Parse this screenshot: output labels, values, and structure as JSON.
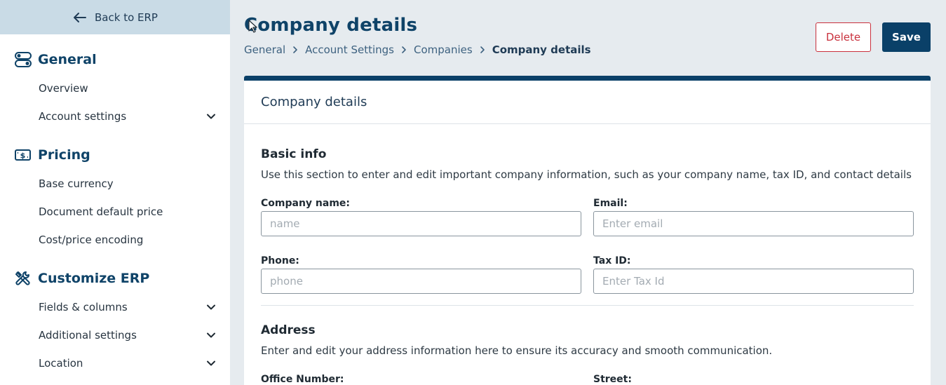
{
  "sidebar": {
    "back_label": "Back to ERP",
    "sections": [
      {
        "title": "General",
        "icon": "toggle-settings-icon",
        "items": [
          {
            "label": "Overview",
            "expandable": false
          },
          {
            "label": "Account settings",
            "expandable": true
          }
        ]
      },
      {
        "title": "Pricing",
        "icon": "currency-icon",
        "items": [
          {
            "label": "Base currency",
            "expandable": false
          },
          {
            "label": "Document default price",
            "expandable": false
          },
          {
            "label": "Cost/price encoding",
            "expandable": false
          }
        ]
      },
      {
        "title": "Customize ERP",
        "icon": "tools-icon",
        "items": [
          {
            "label": "Fields & columns",
            "expandable": true
          },
          {
            "label": "Additional settings",
            "expandable": true
          },
          {
            "label": "Location",
            "expandable": true
          }
        ]
      }
    ]
  },
  "header": {
    "title": "Company details",
    "breadcrumb": [
      "General",
      "Account Settings",
      "Companies",
      "Company details"
    ],
    "delete_label": "Delete",
    "save_label": "Save"
  },
  "card": {
    "title": "Company details",
    "basic": {
      "title": "Basic info",
      "description": "Use this section to enter and edit important company information, such as your company name, tax ID, and contact details",
      "company_name": {
        "label": "Company name:",
        "placeholder": "name",
        "value": ""
      },
      "email": {
        "label": "Email:",
        "placeholder": "Enter email",
        "value": ""
      },
      "phone": {
        "label": "Phone:",
        "placeholder": "phone",
        "value": ""
      },
      "tax_id": {
        "label": "Tax ID:",
        "placeholder": "Enter Tax Id",
        "value": ""
      }
    },
    "address": {
      "title": "Address",
      "description": "Enter and edit your address information here to ensure its accuracy and smooth communication.",
      "office_number": {
        "label": "Office Number:"
      },
      "street": {
        "label": "Street:"
      }
    }
  },
  "colors": {
    "primary": "#0a4068",
    "danger": "#c9303c",
    "sidebar_back_bg": "#c9dbe6",
    "page_bg": "#e6ebef"
  }
}
